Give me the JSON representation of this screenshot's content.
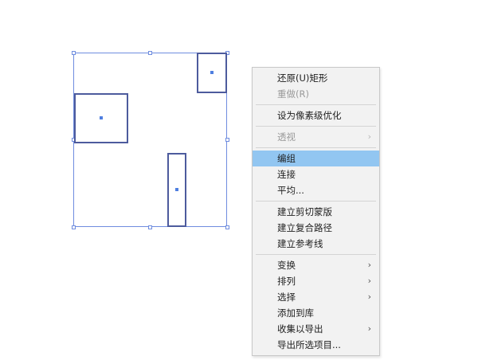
{
  "canvas": {
    "selection_color": "#6f8ddf",
    "shape_stroke_color": "#4d5b9d",
    "center_dot_color": "#4f7fe0"
  },
  "context_menu": {
    "highlight_color": "#92c6f1",
    "groups": [
      [
        {
          "id": "undo",
          "label": "还原(U)矩形",
          "disabled": false
        },
        {
          "id": "redo",
          "label": "重做(R)",
          "disabled": true
        }
      ],
      [
        {
          "id": "pixel-optimize",
          "label": "设为像素级优化",
          "disabled": false
        }
      ],
      [
        {
          "id": "perspective",
          "label": "透视",
          "disabled": true,
          "submenu": true
        }
      ],
      [
        {
          "id": "group",
          "label": "编组",
          "disabled": false,
          "highlighted": true
        },
        {
          "id": "join",
          "label": "连接",
          "disabled": false
        },
        {
          "id": "average",
          "label": "平均...",
          "disabled": false
        }
      ],
      [
        {
          "id": "make-clipping-mask",
          "label": "建立剪切蒙版",
          "disabled": false
        },
        {
          "id": "make-compound-path",
          "label": "建立复合路径",
          "disabled": false
        },
        {
          "id": "make-guides",
          "label": "建立参考线",
          "disabled": false
        }
      ],
      [
        {
          "id": "transform",
          "label": "变换",
          "disabled": false,
          "submenu": true
        },
        {
          "id": "arrange",
          "label": "排列",
          "disabled": false,
          "submenu": true
        },
        {
          "id": "select",
          "label": "选择",
          "disabled": false,
          "submenu": true
        },
        {
          "id": "add-to-library",
          "label": "添加到库",
          "disabled": false
        },
        {
          "id": "collect-for-export",
          "label": "收集以导出",
          "disabled": false,
          "submenu": true
        },
        {
          "id": "export-selection",
          "label": "导出所选项目...",
          "disabled": false
        }
      ]
    ],
    "submenu_icon": "chevron-right-icon",
    "submenu_glyph": "›"
  }
}
